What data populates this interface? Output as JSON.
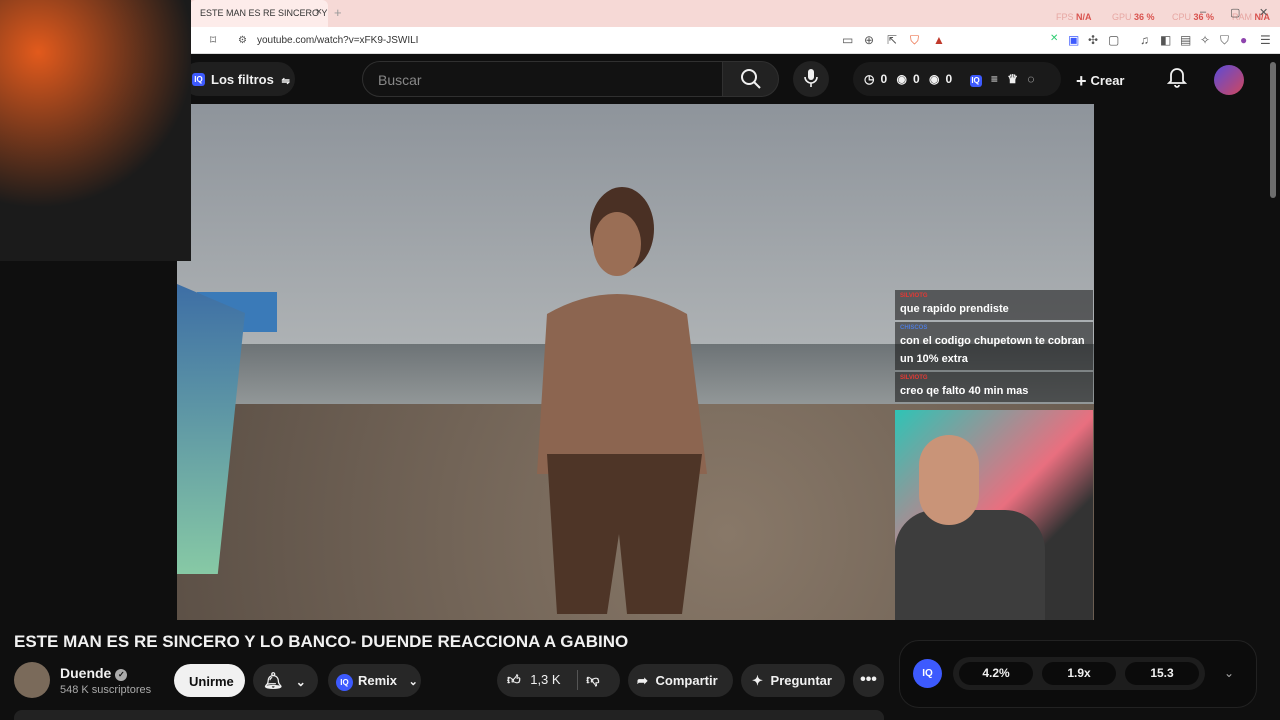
{
  "browser": {
    "tab_title": "ESTE MAN ES RE SINCERO Y ",
    "tab_close": "×",
    "new_tab": "+",
    "url": "youtube.com/watch?v=xFK9-JSWILI",
    "stats": [
      {
        "label": "FPS",
        "value": "N/A"
      },
      {
        "label": "GPU",
        "value": "36 %"
      },
      {
        "label": "CPU",
        "value": "36 %"
      },
      {
        "label": "RAM",
        "value": "N/A"
      }
    ],
    "window_controls": [
      "–",
      "▢",
      "✕"
    ]
  },
  "header": {
    "filters_logo": "IQ",
    "filters_label": "Los filtros",
    "search_placeholder": "Buscar",
    "counters": [
      "0",
      "0",
      "0"
    ],
    "create_label": "Crear"
  },
  "chat": [
    {
      "user": "SILVIOTG",
      "user_color": "#e53935",
      "text": "que rapido prendiste"
    },
    {
      "user": "CHISCOS",
      "user_color": "#4f7bd9",
      "text": "con el codigo chupetown te cobran un 10% extra"
    },
    {
      "user": "SILVIOTG",
      "user_color": "#e53935",
      "text": "creo qe falto 40 min mas"
    }
  ],
  "video": {
    "title": "ESTE MAN ES RE SINCERO Y LO BANCO- DUENDE REACCIONA A GABINO"
  },
  "channel": {
    "name": "Duende",
    "subscribers": "548 K suscriptores",
    "join_label": "Unirme"
  },
  "actions": {
    "remix_label": "Remix",
    "remix_logo": "IQ",
    "likes": "1,3 K",
    "share_label": "Compartir",
    "ask_label": "Preguntar",
    "more": "•••"
  },
  "iq_panel": {
    "logo": "IQ",
    "metrics": [
      "4.2%",
      "1.9x",
      "15.3"
    ]
  }
}
